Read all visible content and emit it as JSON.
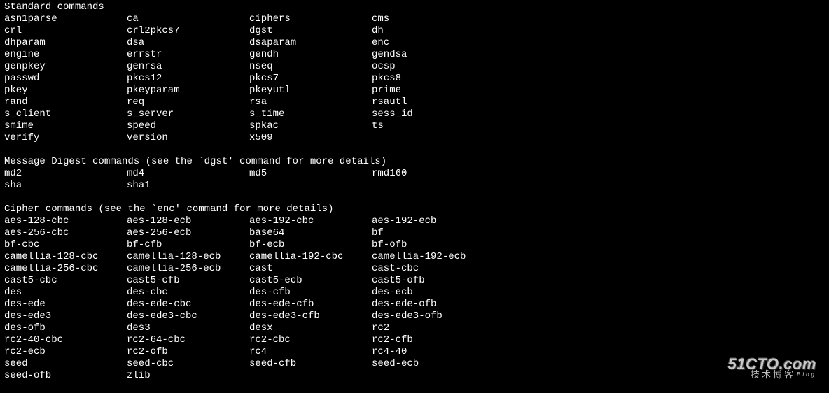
{
  "sections": [
    {
      "title": "Standard commands",
      "rows": [
        [
          "asn1parse",
          "ca",
          "ciphers",
          "cms"
        ],
        [
          "crl",
          "crl2pkcs7",
          "dgst",
          "dh"
        ],
        [
          "dhparam",
          "dsa",
          "dsaparam",
          "enc"
        ],
        [
          "engine",
          "errstr",
          "gendh",
          "gendsa"
        ],
        [
          "genpkey",
          "genrsa",
          "nseq",
          "ocsp"
        ],
        [
          "passwd",
          "pkcs12",
          "pkcs7",
          "pkcs8"
        ],
        [
          "pkey",
          "pkeyparam",
          "pkeyutl",
          "prime"
        ],
        [
          "rand",
          "req",
          "rsa",
          "rsautl"
        ],
        [
          "s_client",
          "s_server",
          "s_time",
          "sess_id"
        ],
        [
          "smime",
          "speed",
          "spkac",
          "ts"
        ],
        [
          "verify",
          "version",
          "x509",
          ""
        ]
      ]
    },
    {
      "title": "Message Digest commands (see the `dgst' command for more details)",
      "rows": [
        [
          "md2",
          "md4",
          "md5",
          "rmd160"
        ],
        [
          "sha",
          "sha1",
          "",
          ""
        ]
      ]
    },
    {
      "title": "Cipher commands (see the `enc' command for more details)",
      "rows": [
        [
          "aes-128-cbc",
          "aes-128-ecb",
          "aes-192-cbc",
          "aes-192-ecb"
        ],
        [
          "aes-256-cbc",
          "aes-256-ecb",
          "base64",
          "bf"
        ],
        [
          "bf-cbc",
          "bf-cfb",
          "bf-ecb",
          "bf-ofb"
        ],
        [
          "camellia-128-cbc",
          "camellia-128-ecb",
          "camellia-192-cbc",
          "camellia-192-ecb"
        ],
        [
          "camellia-256-cbc",
          "camellia-256-ecb",
          "cast",
          "cast-cbc"
        ],
        [
          "cast5-cbc",
          "cast5-cfb",
          "cast5-ecb",
          "cast5-ofb"
        ],
        [
          "des",
          "des-cbc",
          "des-cfb",
          "des-ecb"
        ],
        [
          "des-ede",
          "des-ede-cbc",
          "des-ede-cfb",
          "des-ede-ofb"
        ],
        [
          "des-ede3",
          "des-ede3-cbc",
          "des-ede3-cfb",
          "des-ede3-ofb"
        ],
        [
          "des-ofb",
          "des3",
          "desx",
          "rc2"
        ],
        [
          "rc2-40-cbc",
          "rc2-64-cbc",
          "rc2-cbc",
          "rc2-cfb"
        ],
        [
          "rc2-ecb",
          "rc2-ofb",
          "rc4",
          "rc4-40"
        ],
        [
          "seed",
          "seed-cbc",
          "seed-cfb",
          "seed-ecb"
        ],
        [
          "seed-ofb",
          "zlib",
          "",
          ""
        ]
      ]
    }
  ],
  "watermark": {
    "main": "51CTO.com",
    "sub": "技术博客",
    "tag": "Blog"
  }
}
